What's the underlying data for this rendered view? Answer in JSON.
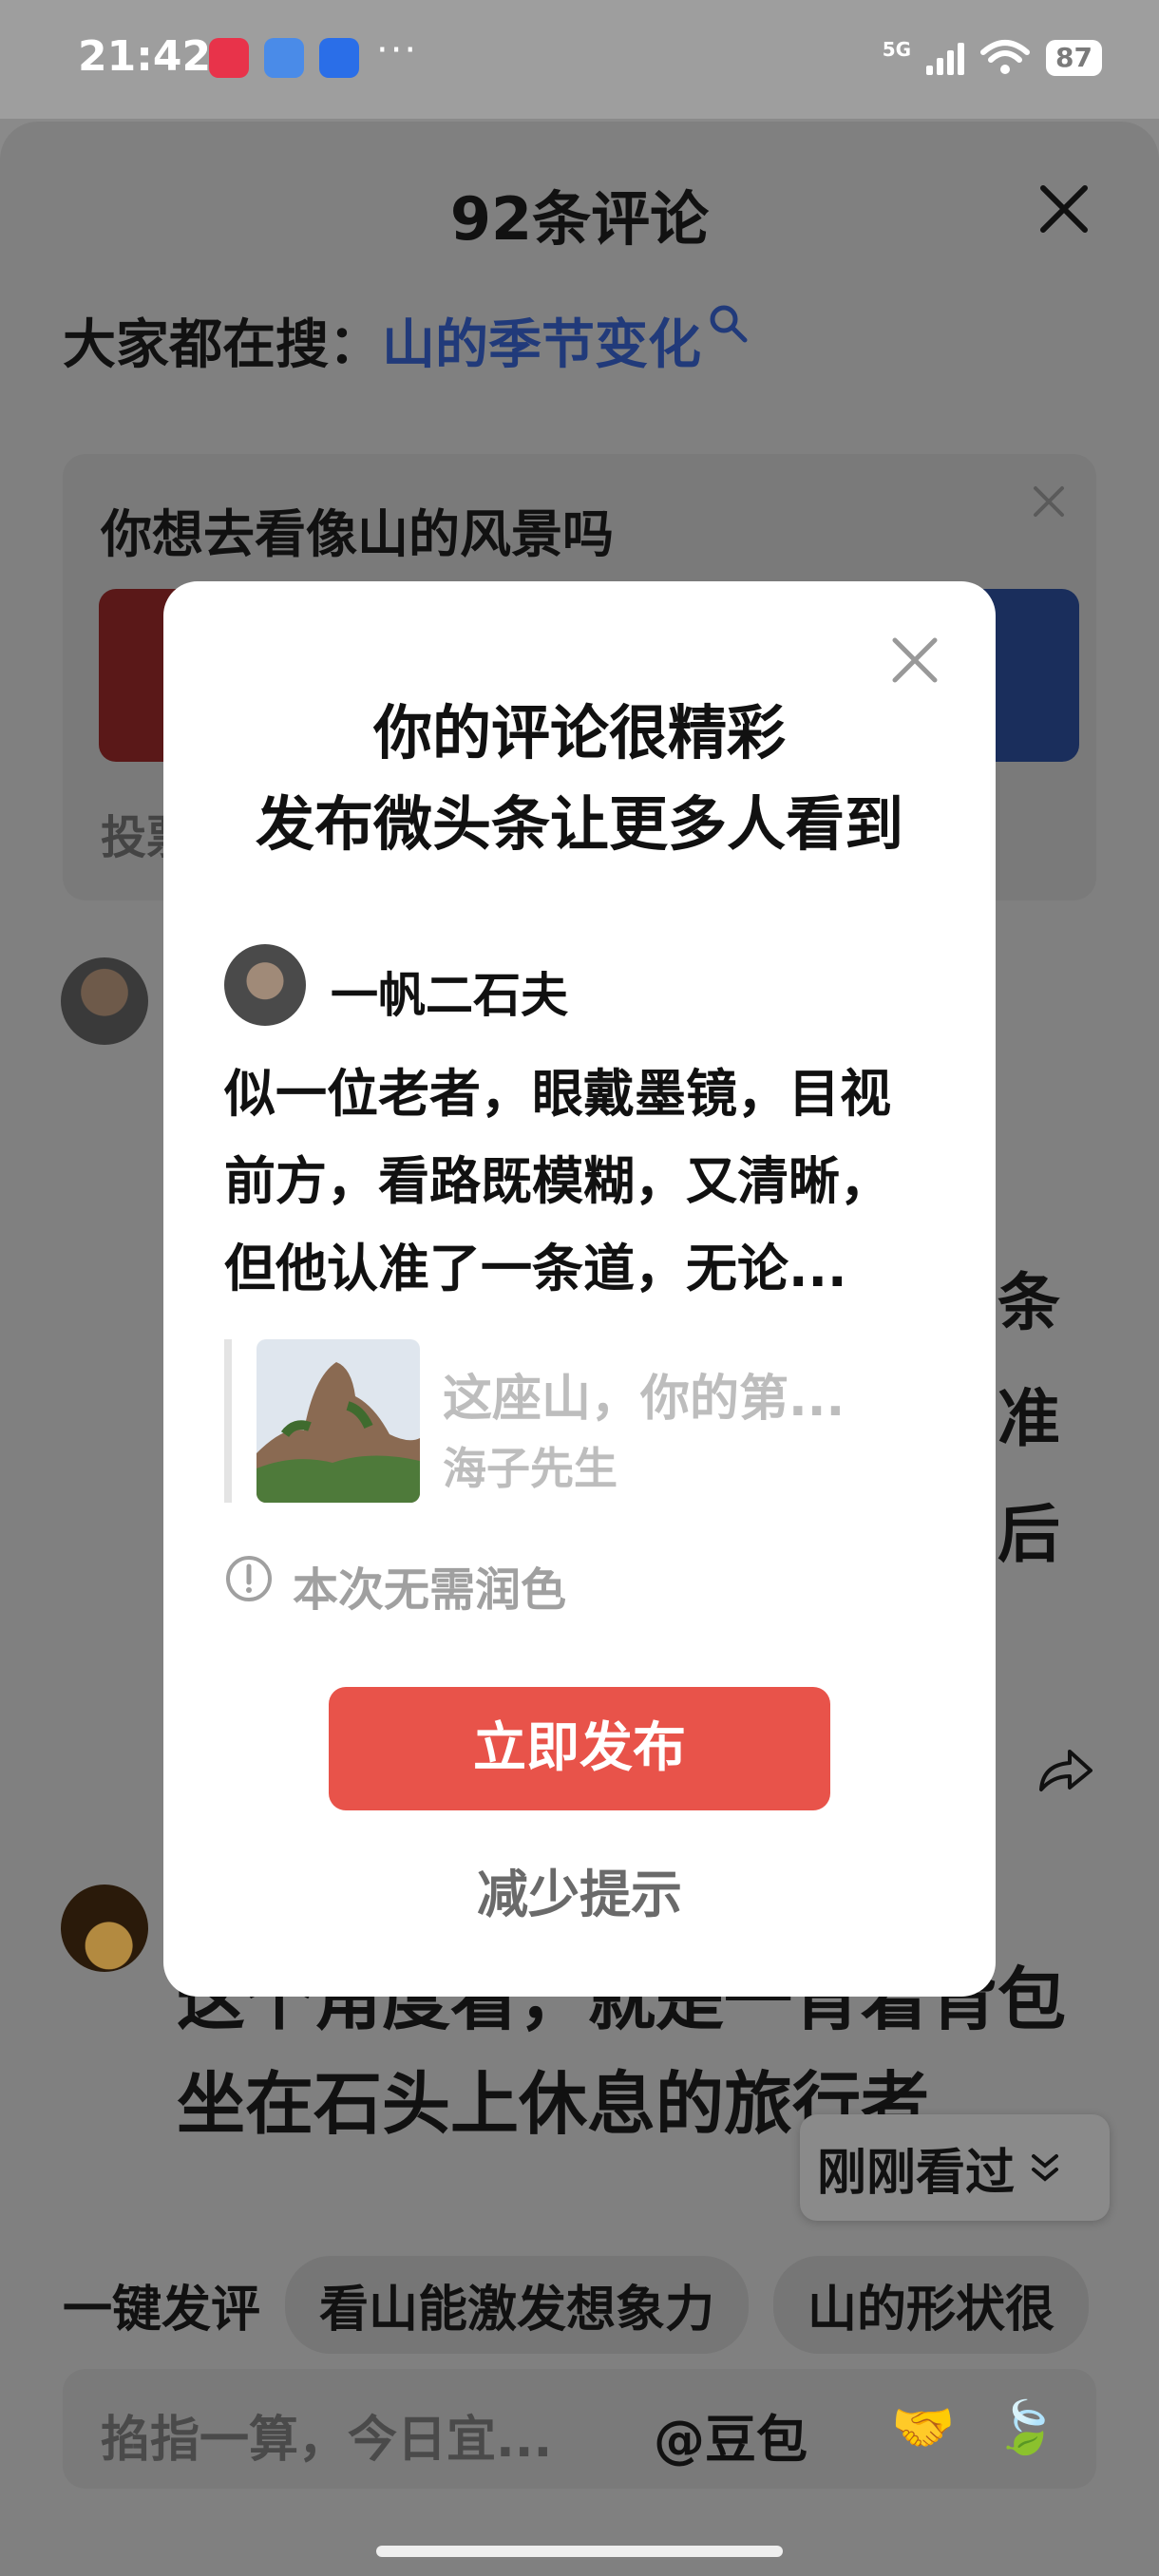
{
  "status_bar": {
    "time": "21:42",
    "network": "5G",
    "battery": "87",
    "more": "···",
    "app_icons": [
      "red-app-icon",
      "wallet-app-icon",
      "blue-app-icon"
    ],
    "colors": {
      "red": "#e8334a",
      "wallet": "#4a8be8",
      "blue": "#2a6ee8"
    }
  },
  "sheet": {
    "title": "92条评论",
    "search_prefix": "大家都在搜：",
    "search_term": "山的季节变化"
  },
  "poll": {
    "title": "你想去看像山的风景吗",
    "vote_label": "投票"
  },
  "background_comment1": {
    "peek_chars": [
      "条",
      "准",
      "后"
    ]
  },
  "background_comment2": {
    "text": "这个角度看，就是一背着背包坐在石头上休息的旅行者"
  },
  "recent": {
    "label": "刚刚看过"
  },
  "quick_reply": {
    "label": "一键发评",
    "chips": [
      "看山能激发想象力",
      "山的形状很"
    ]
  },
  "input": {
    "placeholder": "掐指一算，今日宜...",
    "mention": "@豆包",
    "emojis": [
      "🤝",
      "🍃"
    ]
  },
  "modal": {
    "heading_line1": "你的评论很精彩",
    "heading_line2": "发布微头条让更多人看到",
    "username": "一帆二石夫",
    "comment_line1": "似一位老者，眼戴墨镜，目视",
    "comment_line2": "前方，看路既模糊，又清晰，",
    "comment_line3": "但他认准了一条道，无论...",
    "quote_title": "这座山，你的第...",
    "quote_author": "海子先生",
    "notice": "本次无需润色",
    "publish_label": "立即发布",
    "reduce_label": "减少提示",
    "accent_color": "#e8534a"
  }
}
